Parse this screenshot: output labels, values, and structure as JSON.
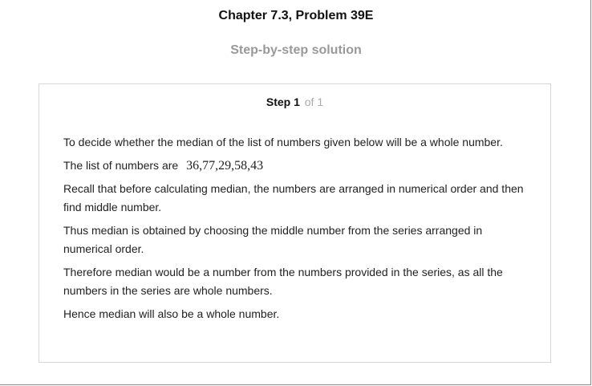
{
  "header": {
    "chapter_title": "Chapter 7.3, Problem 39E",
    "subtitle": "Step-by-step solution"
  },
  "step": {
    "label": "Step 1",
    "of_label": "of 1",
    "paragraphs": {
      "p1": "To decide whether the median of the list of numbers given below will be a whole number.",
      "p2_text": "The list of numbers are",
      "p2_math": "36,77,29,58,43",
      "p3": "Recall that before calculating median, the numbers are arranged in numerical order and then find middle number.",
      "p4": "Thus median is obtained by choosing the middle number from the series arranged in numerical order.",
      "p5": "Therefore median would be a number from the numbers provided in the series, as all the numbers in the series are whole numbers.",
      "p6": "Hence median will also be a whole number."
    }
  }
}
